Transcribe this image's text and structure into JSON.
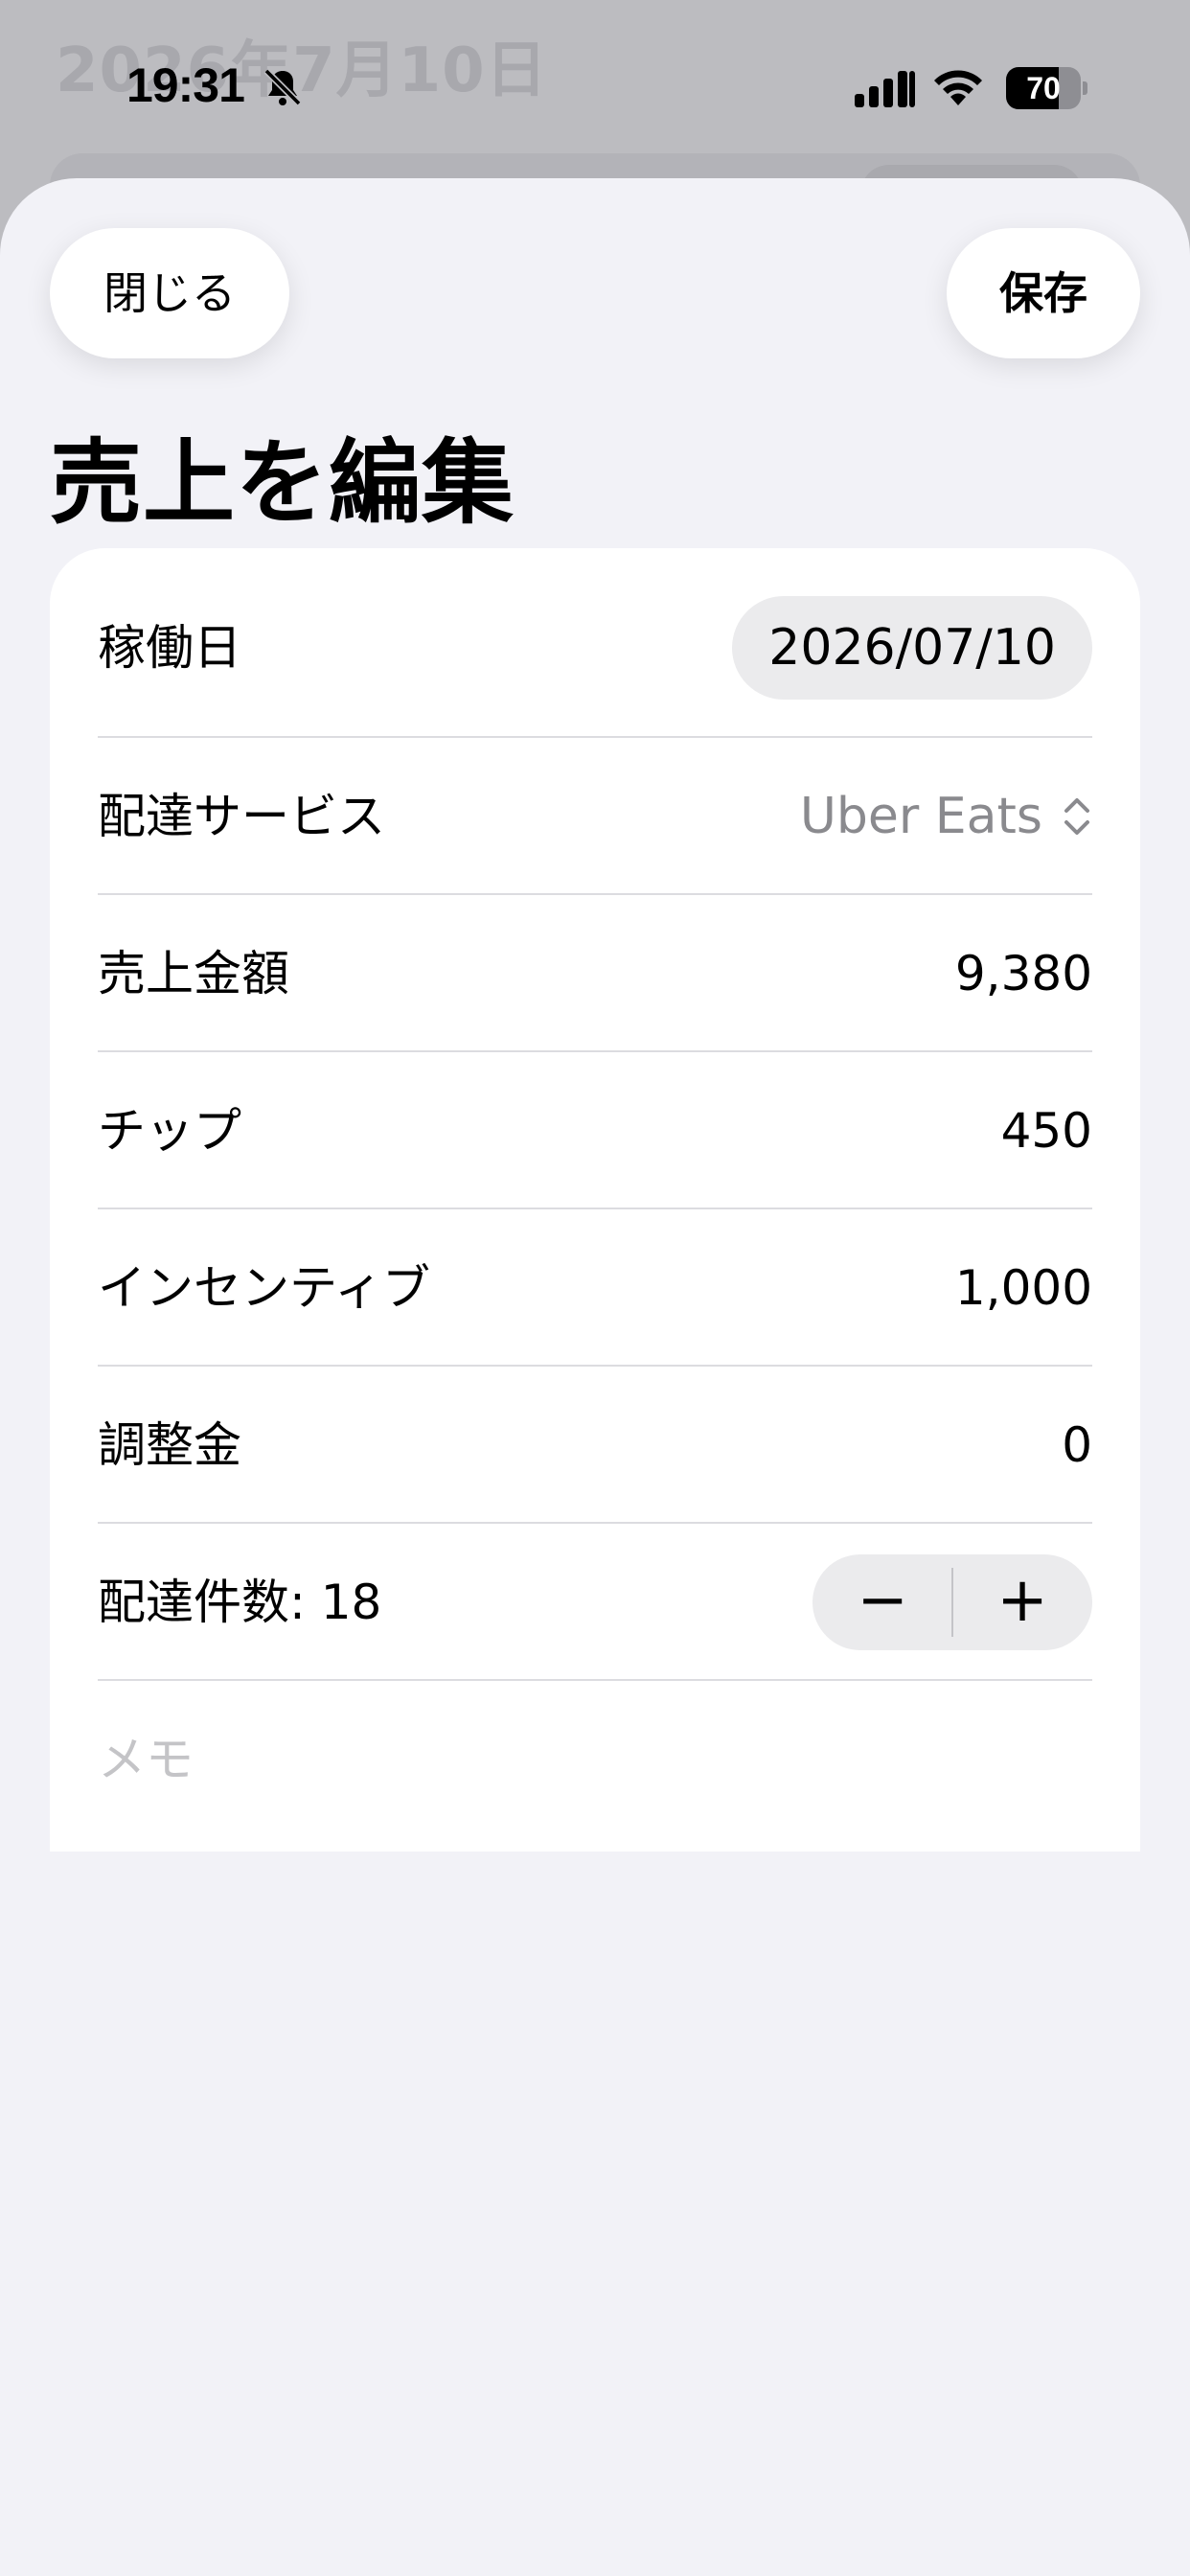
{
  "background": {
    "title": "2026年7月10日"
  },
  "status_bar": {
    "time": "19:31",
    "battery_level": 70,
    "battery_label": "70",
    "icons": [
      "bell-slash-icon",
      "cellular-signal-icon",
      "wifi-icon",
      "battery-icon"
    ]
  },
  "sheet": {
    "close_label": "閉じる",
    "save_label": "保存",
    "title": "売上を編集"
  },
  "form": {
    "date": {
      "label": "稼働日",
      "value": "2026/07/10"
    },
    "service": {
      "label": "配達サービス",
      "value": "Uber Eats",
      "icon": "chevron-up-down-icon"
    },
    "sales": {
      "label": "売上金額",
      "value": "9,380"
    },
    "tip": {
      "label": "チップ",
      "value": "450"
    },
    "incentive": {
      "label": "インセンティブ",
      "value": "1,000"
    },
    "adjustment": {
      "label": "調整金",
      "value": "0"
    },
    "deliveries": {
      "label": "配達件数: 18",
      "minus": "−",
      "plus": "+"
    },
    "memo": {
      "placeholder": "メモ"
    }
  }
}
